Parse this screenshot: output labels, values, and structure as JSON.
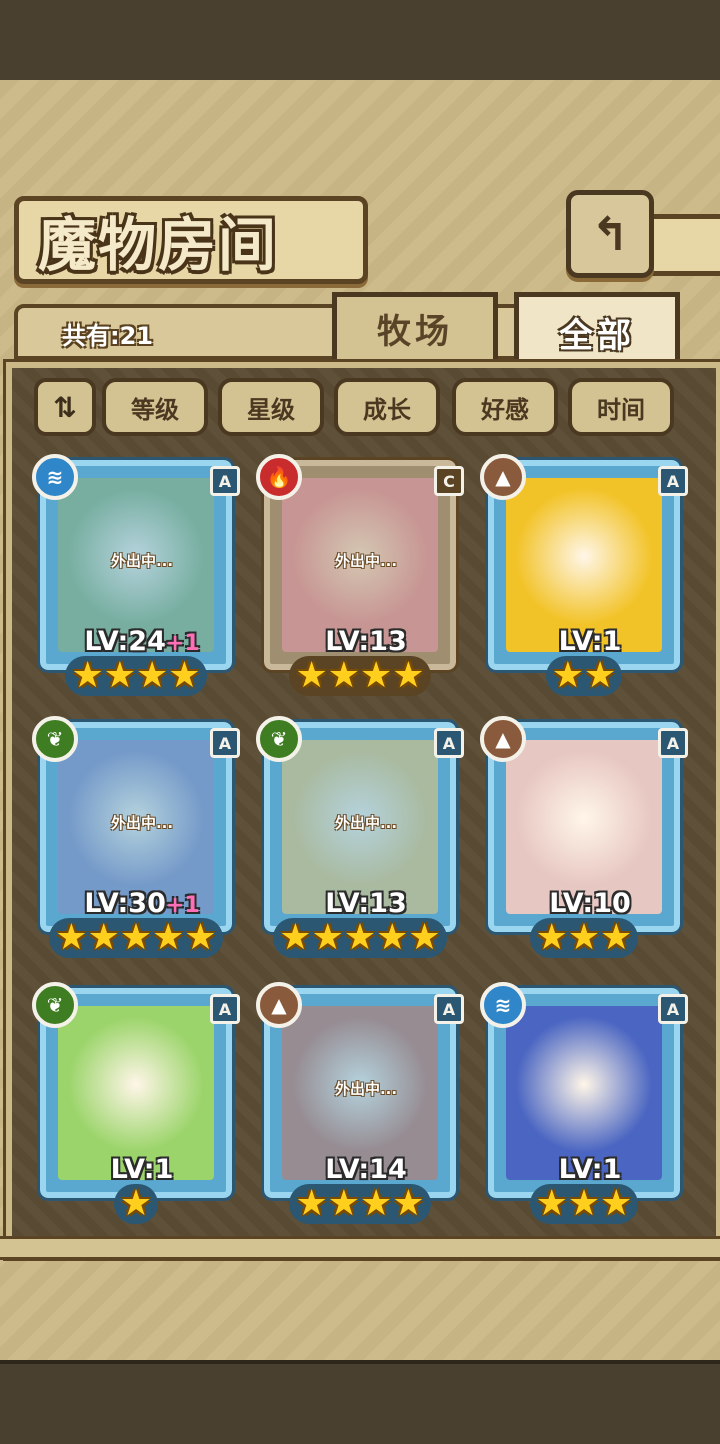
{
  "header": {
    "title": "魔物房间",
    "back_icon": "↰"
  },
  "count_label": "共有:21",
  "tabs": [
    {
      "label": "牧场",
      "active": false
    },
    {
      "label": "全部",
      "active": true
    }
  ],
  "sort_toggle_icon": "⇅",
  "filters": [
    "等级",
    "星级",
    "成长",
    "好感",
    "时间"
  ],
  "away_text": "外出中...",
  "cards": [
    {
      "element": "water",
      "element_icon": "≋",
      "rank": "A",
      "level": "LV:24",
      "bonus": "+1",
      "stars": 4,
      "away": true,
      "frame": "blue",
      "art_color": "#8fb47a"
    },
    {
      "element": "fire",
      "element_icon": "🔥",
      "rank": "C",
      "level": "LV:13",
      "bonus": "",
      "stars": 4,
      "away": true,
      "frame": "copper",
      "art_color": "#e79bb0"
    },
    {
      "element": "earth",
      "element_icon": "▲",
      "rank": "A",
      "level": "LV:1",
      "bonus": "",
      "stars": 2,
      "away": false,
      "frame": "blue",
      "art_color": "#f2c329"
    },
    {
      "element": "plant",
      "element_icon": "❦",
      "rank": "A",
      "level": "LV:30",
      "bonus": "+1",
      "stars": 5,
      "away": true,
      "frame": "blue",
      "art_color": "#8a8fc4"
    },
    {
      "element": "plant",
      "element_icon": "❦",
      "rank": "A",
      "level": "LV:13",
      "bonus": "",
      "stars": 5,
      "away": true,
      "frame": "blue",
      "art_color": "#e9c978"
    },
    {
      "element": "earth",
      "element_icon": "▲",
      "rank": "A",
      "level": "LV:10",
      "bonus": "",
      "stars": 3,
      "away": false,
      "frame": "blue",
      "art_color": "#e7c7c2"
    },
    {
      "element": "plant",
      "element_icon": "❦",
      "rank": "A",
      "level": "LV:1",
      "bonus": "",
      "stars": 1,
      "away": false,
      "frame": "blue",
      "art_color": "#9bd46a"
    },
    {
      "element": "earth",
      "element_icon": "▲",
      "rank": "A",
      "level": "LV:14",
      "bonus": "",
      "stars": 4,
      "away": true,
      "frame": "blue",
      "art_color": "#c77560"
    },
    {
      "element": "water",
      "element_icon": "≋",
      "rank": "A",
      "level": "LV:1",
      "bonus": "",
      "stars": 3,
      "away": false,
      "frame": "blue",
      "art_color": "#4b66c2"
    }
  ]
}
